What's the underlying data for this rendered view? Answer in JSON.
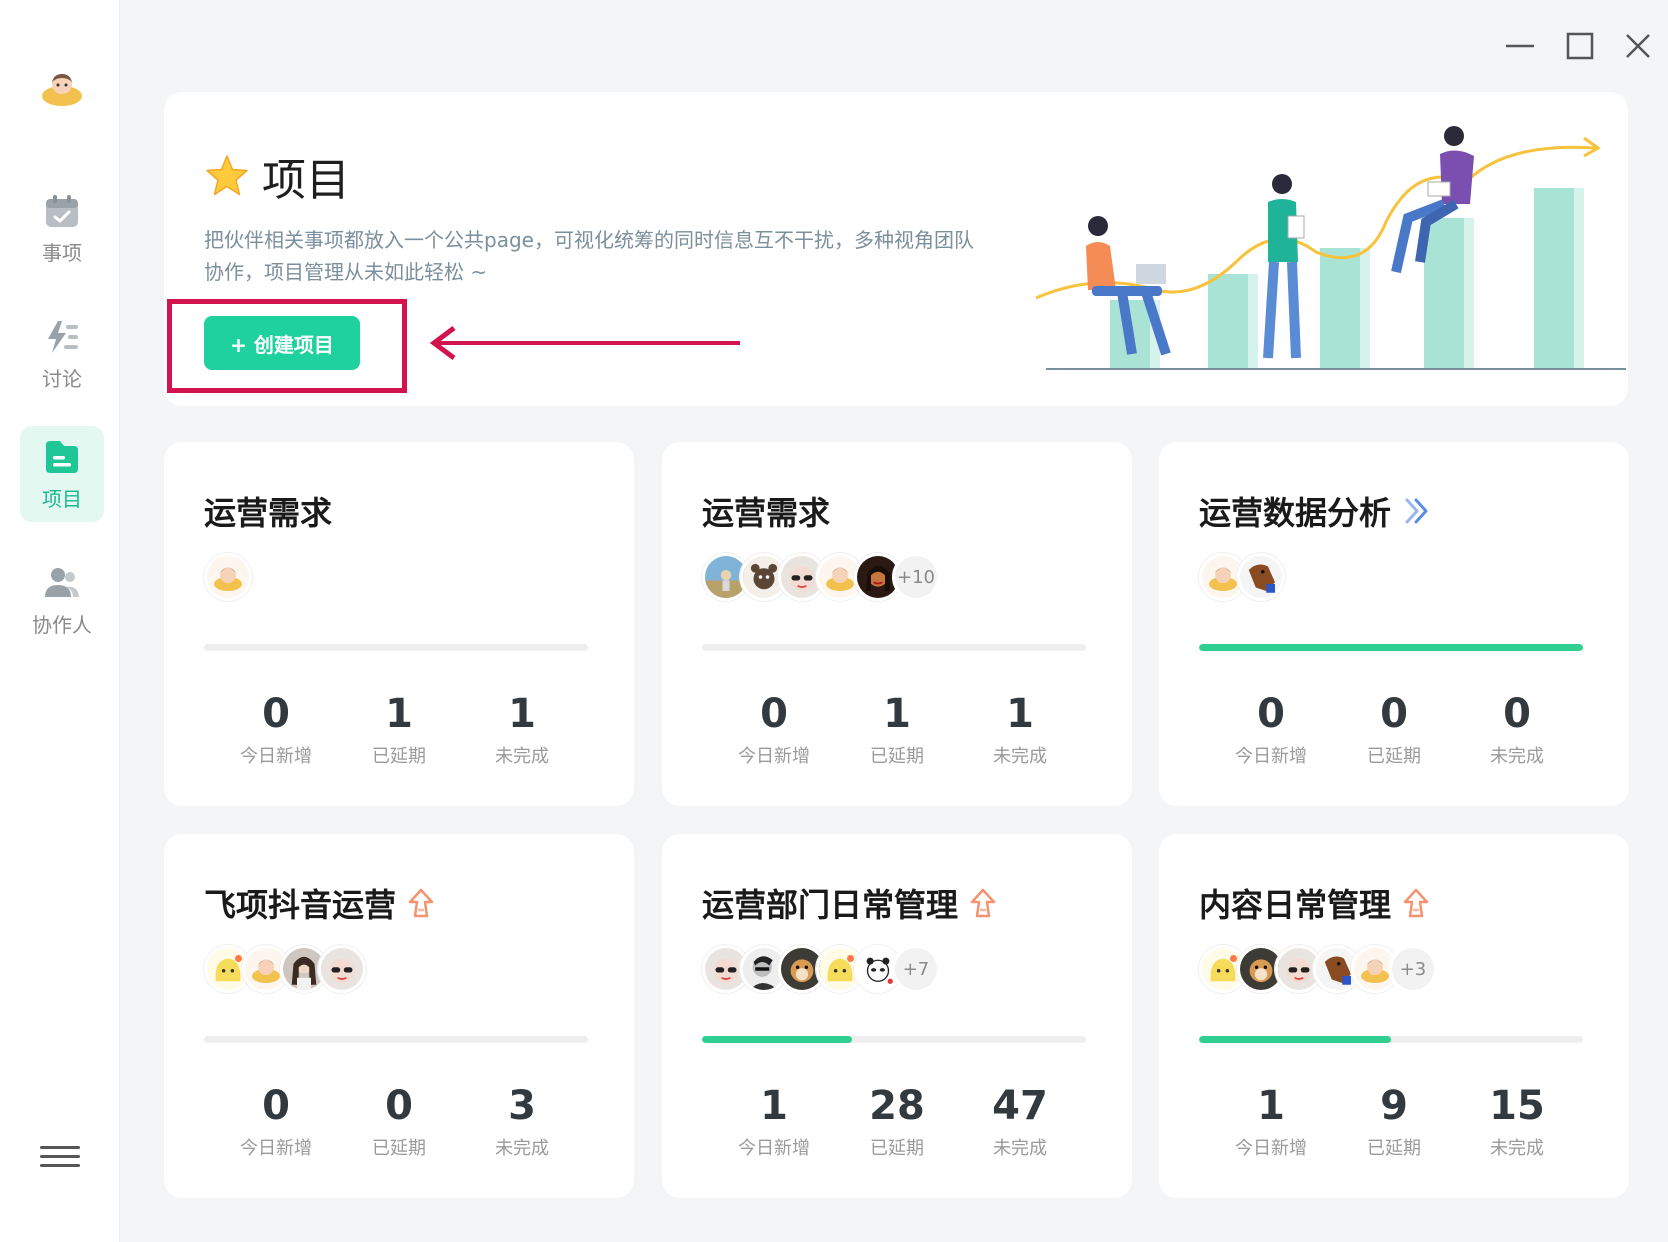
{
  "sidebar": {
    "items": [
      {
        "label": "事项",
        "icon": "calendar-check-icon",
        "active": false
      },
      {
        "label": "讨论",
        "icon": "lightning-list-icon",
        "active": false
      },
      {
        "label": "项目",
        "icon": "folder-icon",
        "active": true
      },
      {
        "label": "协作人",
        "icon": "people-icon",
        "active": false
      }
    ],
    "menu_icon": "hamburger-menu-icon"
  },
  "header": {
    "title": "项目",
    "description": "把伙伴相关事项都放入一个公共page，可视化统筹的同时信息互不干扰，多种视角团队协作，项目管理从未如此轻松 ~",
    "create_button": "+ 创建项目"
  },
  "colors": {
    "accent": "#1fd19e",
    "highlight": "#d3134d",
    "progress": "#2fcf8f"
  },
  "projects": [
    {
      "title": "运营需求",
      "badge": "",
      "avatars": [
        "avatar-cartoon"
      ],
      "more": "",
      "progress": 0,
      "stats": [
        {
          "value": "0",
          "label": "今日新增"
        },
        {
          "value": "1",
          "label": "已延期"
        },
        {
          "value": "1",
          "label": "未完成"
        }
      ]
    },
    {
      "title": "运营需求",
      "badge": "",
      "avatars": [
        "avatar-photo-landscape",
        "avatar-dog",
        "avatar-sunglasses",
        "avatar-cartoon",
        "avatar-woman"
      ],
      "more": "+10",
      "progress": 0,
      "stats": [
        {
          "value": "0",
          "label": "今日新增"
        },
        {
          "value": "1",
          "label": "已延期"
        },
        {
          "value": "1",
          "label": "未完成"
        }
      ]
    },
    {
      "title": "运营数据分析",
      "badge": "sync-down-icon",
      "avatars": [
        "avatar-cartoon",
        "avatar-brown-dog"
      ],
      "more": "",
      "progress": 100,
      "stats": [
        {
          "value": "0",
          "label": "今日新增"
        },
        {
          "value": "0",
          "label": "已延期"
        },
        {
          "value": "0",
          "label": "未完成"
        }
      ]
    },
    {
      "title": "飞项抖音运营",
      "badge": "share-up-icon",
      "avatars": [
        "avatar-yellow",
        "avatar-cartoon",
        "avatar-woman-photo",
        "avatar-sunglasses"
      ],
      "more": "",
      "progress": 0,
      "stats": [
        {
          "value": "0",
          "label": "今日新增"
        },
        {
          "value": "0",
          "label": "已延期"
        },
        {
          "value": "3",
          "label": "未完成"
        }
      ]
    },
    {
      "title": "运营部门日常管理",
      "badge": "share-up-icon",
      "avatars": [
        "avatar-sunglasses",
        "avatar-bw-man",
        "avatar-dog-photo",
        "avatar-yellow",
        "avatar-panda"
      ],
      "more": "+7",
      "progress": 39,
      "stats": [
        {
          "value": "1",
          "label": "今日新增"
        },
        {
          "value": "28",
          "label": "已延期"
        },
        {
          "value": "47",
          "label": "未完成"
        }
      ]
    },
    {
      "title": "内容日常管理",
      "badge": "share-up-icon",
      "avatars": [
        "avatar-yellow",
        "avatar-dog-photo",
        "avatar-sunglasses",
        "avatar-brown-dog",
        "avatar-cartoon"
      ],
      "more": "+3",
      "progress": 50,
      "stats": [
        {
          "value": "1",
          "label": "今日新增"
        },
        {
          "value": "9",
          "label": "已延期"
        },
        {
          "value": "15",
          "label": "未完成"
        }
      ]
    }
  ]
}
